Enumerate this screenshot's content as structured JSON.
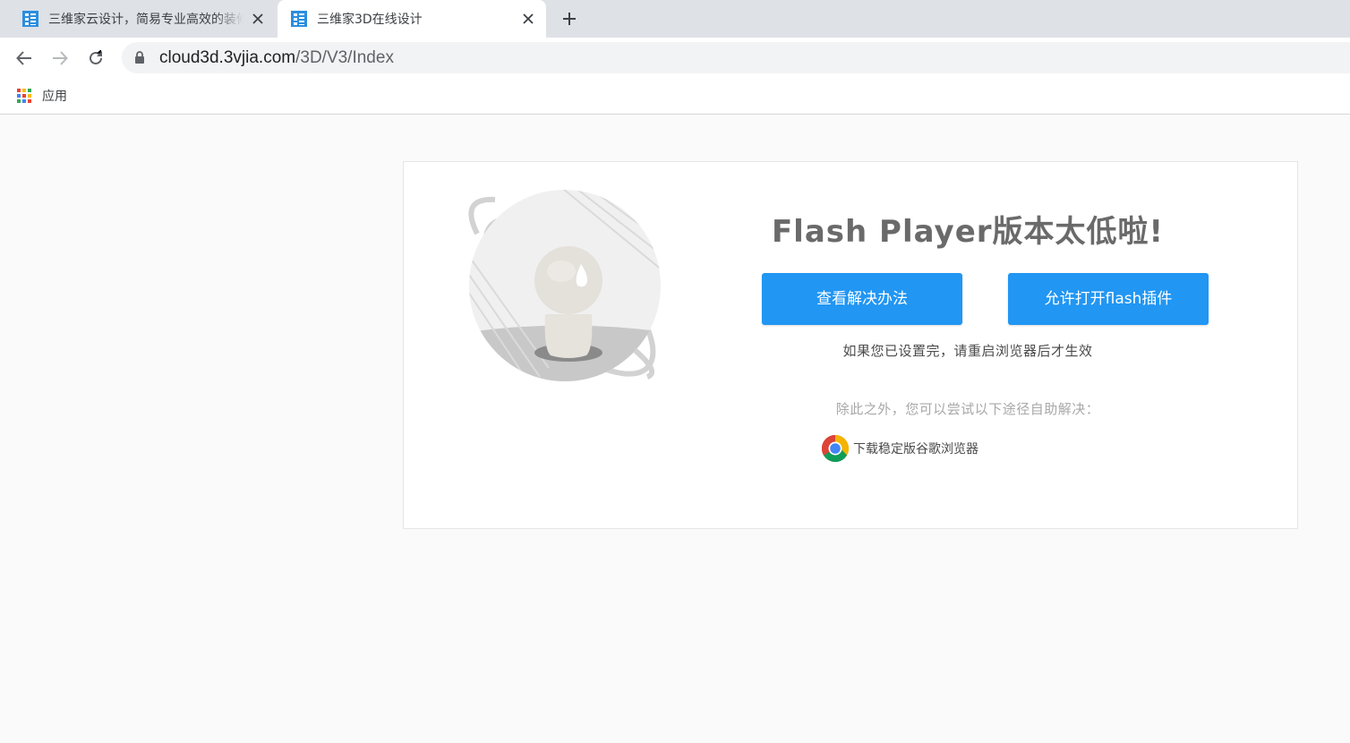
{
  "browser": {
    "tabs": [
      {
        "title": "三维家云设计，简易专业高效的装修设计",
        "active": false
      },
      {
        "title": "三维家3D在线设计",
        "active": true
      }
    ],
    "address": {
      "host": "cloud3d.3vjia.com",
      "path": "/3D/V3/Index"
    },
    "bookmarks": [
      {
        "label": "应用"
      }
    ]
  },
  "page": {
    "headline": "Flash Player版本太低啦!",
    "buttons": {
      "solution": "查看解决办法",
      "allow_flash": "允许打开flash插件"
    },
    "restart_note": "如果您已设置完，请重启浏览器后才生效",
    "alternative_note": "除此之外，您可以尝试以下途径自助解决：",
    "chrome_download": "下载稳定版谷歌浏览器"
  },
  "colors": {
    "button": "#2196f3",
    "headline": "#6a6a6a",
    "tabstrip": "#dee1e6",
    "page_bg": "#fafafa"
  },
  "icons": [
    "site-favicon",
    "close-icon",
    "plus-icon",
    "back-arrow-icon",
    "forward-arrow-icon",
    "reload-icon",
    "lock-icon",
    "apps-grid-icon",
    "chrome-logo-icon",
    "sad-character-illustration"
  ]
}
